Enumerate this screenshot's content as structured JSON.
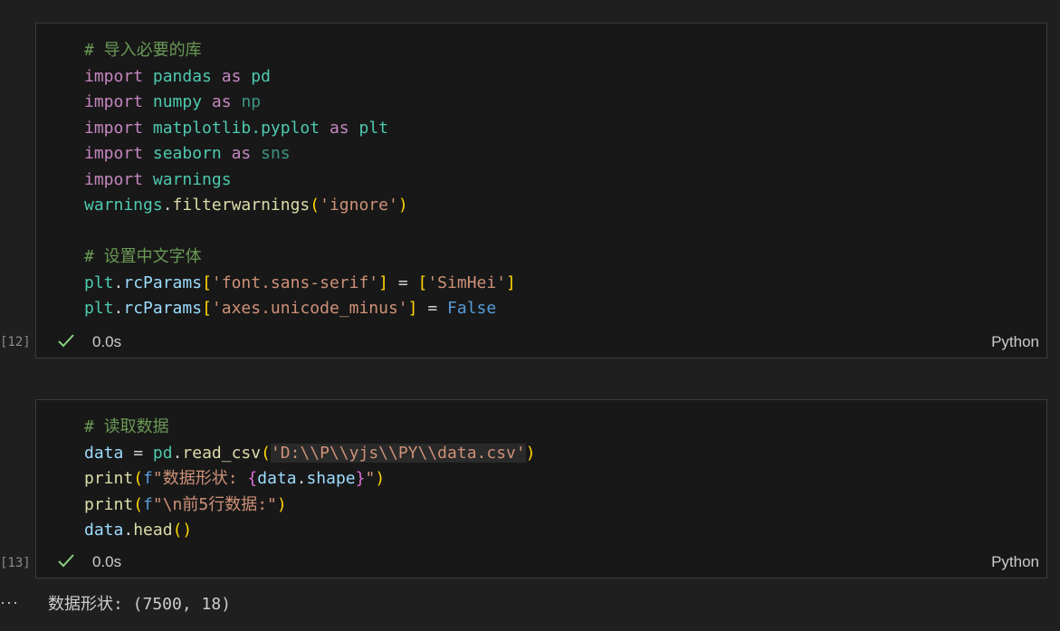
{
  "cells": [
    {
      "execution_count": "[12]",
      "status_time": "0.0s",
      "language": "Python",
      "lines": [
        {
          "comment": "# 导入必要的库"
        },
        {
          "kw1": "import",
          "mod": "pandas",
          "kw2": "as",
          "alias": "pd"
        },
        {
          "kw1": "import",
          "mod": "numpy",
          "kw2": "as",
          "alias": "np"
        },
        {
          "kw1": "import",
          "mod": "matplotlib.pyplot",
          "kw2": "as",
          "alias": "plt"
        },
        {
          "kw1": "import",
          "mod": "seaborn",
          "kw2": "as",
          "alias": "sns"
        },
        {
          "kw1": "import",
          "mod": "warnings"
        },
        {
          "obj": "warnings",
          "dot": ".",
          "fn": "filterwarnings",
          "open": "(",
          "arg": "'ignore'",
          "close": ")"
        },
        {},
        {
          "comment": "# 设置中文字体"
        },
        {
          "obj": "plt",
          "dot": ".",
          "attr": "rcParams",
          "open": "[",
          "key": "'font.sans-serif'",
          "close": "]",
          "eq": " = ",
          "lopen": "[",
          "val": "'SimHei'",
          "lclose": "]"
        },
        {
          "obj": "plt",
          "dot": ".",
          "attr": "rcParams",
          "open": "[",
          "key": "'axes.unicode_minus'",
          "close": "]",
          "eq": " = ",
          "val": "False"
        }
      ]
    },
    {
      "execution_count": "[13]",
      "status_time": "0.0s",
      "language": "Python",
      "lines": [
        {
          "comment": "# 读取数据"
        },
        {
          "var": "data",
          "eq": " = ",
          "obj": "pd",
          "dot": ".",
          "fn": "read_csv",
          "open": "(",
          "arg": "'D:\\\\P\\\\yjs\\\\PY\\\\data.csv'",
          "close": ")"
        },
        {
          "fn": "print",
          "open": "(",
          "prefix": "f",
          "s1": "\"数据形状: ",
          "bopen": "{",
          "expr_obj": "data",
          "expr_dot": ".",
          "expr_attr": "shape",
          "bclose": "}",
          "s2": "\"",
          "close": ")"
        },
        {
          "fn": "print",
          "open": "(",
          "prefix": "f",
          "s1": "\"\\n前5行数据:\"",
          "close": ")"
        },
        {
          "obj": "data",
          "dot": ".",
          "fn": "head",
          "open": "(",
          "close": ")"
        }
      ]
    }
  ],
  "output": {
    "ellipsis": "···",
    "text": "数据形状: (7500, 18)"
  },
  "colors": {
    "background": "#1f1f1f",
    "cell_background": "#181818",
    "check": "#89d185"
  }
}
